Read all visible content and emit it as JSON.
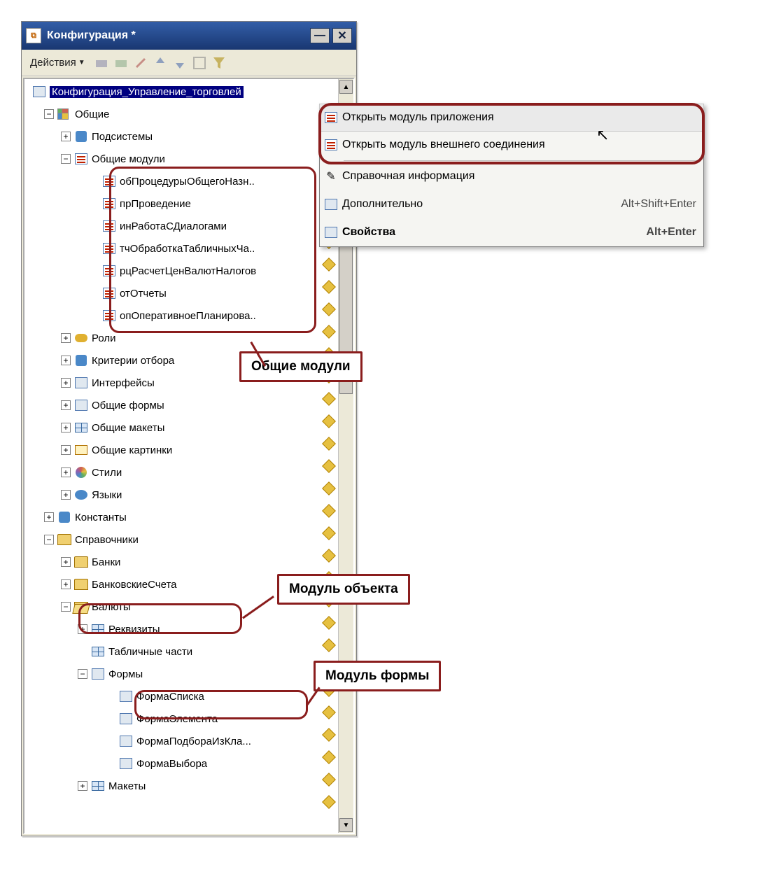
{
  "titlebar": {
    "title": "Конфигурация *"
  },
  "toolbar": {
    "actions": "Действия"
  },
  "tree": {
    "root": "Конфигурация_Управление_торговлей",
    "common": "Общие",
    "subsystems": "Подсистемы",
    "common_modules": "Общие модули",
    "modules": [
      "обПроцедурыОбщегоНазн..",
      "прПроведение",
      "инРаботаСДиалогами",
      "тчОбработкаТабличныхЧа..",
      "рцРасчетЦенВалютНалогов",
      "отОтчеты",
      "опОперативноеПланирова.."
    ],
    "roles": "Роли",
    "criteria": "Критерии отбора",
    "interfaces": "Интерфейсы",
    "common_forms": "Общие формы",
    "common_templates": "Общие макеты",
    "common_pictures": "Общие картинки",
    "styles": "Стили",
    "languages": "Языки",
    "constants": "Константы",
    "catalogs": "Справочники",
    "banks": "Банки",
    "bank_accounts": "БанковскиеСчета",
    "currencies": "Валюты",
    "attributes": "Реквизиты",
    "tabular": "Табличные части",
    "forms": "Формы",
    "form_list": "ФормаСписка",
    "form_element": "ФормаЭлемента",
    "form_select_cls": "ФормаПодбораИзКла...",
    "form_choice": "ФормаВыбора",
    "templates": "Макеты"
  },
  "callouts": {
    "common_modules": "Общие модули",
    "object_module": "Модуль объекта",
    "form_module": "Модуль формы"
  },
  "context_menu": {
    "open_app_module": "Открыть модуль приложения",
    "open_ext_conn": "Открыть модуль внешнего соединения",
    "help": "Справочная информация",
    "additional": "Дополнительно",
    "additional_acc": "Alt+Shift+Enter",
    "properties": "Свойства",
    "properties_acc": "Alt+Enter"
  }
}
